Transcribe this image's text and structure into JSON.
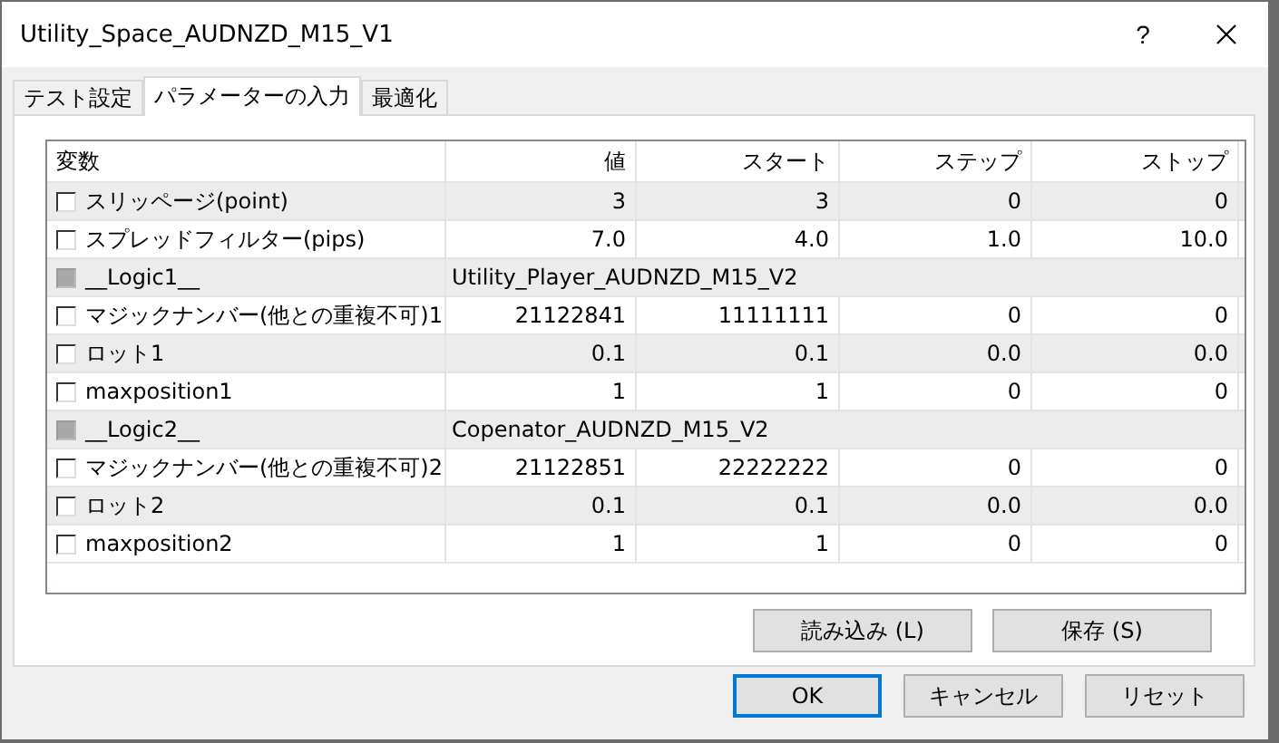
{
  "window": {
    "title": "Utility_Space_AUDNZD_M15_V1",
    "help": "?"
  },
  "tabs": [
    {
      "label": "テスト設定",
      "selected": false
    },
    {
      "label": "パラメーターの入力",
      "selected": true
    },
    {
      "label": "最適化",
      "selected": false
    }
  ],
  "table": {
    "columns": [
      "変数",
      "値",
      "スタート",
      "ステップ",
      "ストップ"
    ],
    "rows": [
      {
        "kind": "param",
        "checked": false,
        "name": "スリッページ(point)",
        "value": "3",
        "start": "3",
        "step": "0",
        "stop": "0"
      },
      {
        "kind": "param",
        "checked": false,
        "name": "スプレッドフィルター(pips)",
        "value": "7.0",
        "start": "4.0",
        "step": "1.0",
        "stop": "10.0"
      },
      {
        "kind": "group",
        "disabled": true,
        "name": "__Logic1__",
        "value": "Utility_Player_AUDNZD_M15_V2"
      },
      {
        "kind": "param",
        "checked": false,
        "name": "マジックナンバー(他との重複不可)1",
        "value": "21122841",
        "start": "11111111",
        "step": "0",
        "stop": "0"
      },
      {
        "kind": "param",
        "checked": false,
        "name": "ロット1",
        "value": "0.1",
        "start": "0.1",
        "step": "0.0",
        "stop": "0.0"
      },
      {
        "kind": "param",
        "checked": false,
        "name": "maxposition1",
        "value": "1",
        "start": "1",
        "step": "0",
        "stop": "0"
      },
      {
        "kind": "group",
        "disabled": true,
        "name": "__Logic2__",
        "value": "Copenator_AUDNZD_M15_V2"
      },
      {
        "kind": "param",
        "checked": false,
        "name": "マジックナンバー(他との重複不可)2",
        "value": "21122851",
        "start": "22222222",
        "step": "0",
        "stop": "0"
      },
      {
        "kind": "param",
        "checked": false,
        "name": "ロット2",
        "value": "0.1",
        "start": "0.1",
        "step": "0.0",
        "stop": "0.0"
      },
      {
        "kind": "param",
        "checked": false,
        "name": "maxposition2",
        "value": "1",
        "start": "1",
        "step": "0",
        "stop": "0"
      }
    ]
  },
  "panel_buttons": [
    "読み込み (L)",
    "保存 (S)"
  ],
  "dialog_buttons": [
    {
      "label": "OK",
      "default": true
    },
    {
      "label": "キャンセル",
      "default": false
    },
    {
      "label": "リセット",
      "default": false
    }
  ]
}
